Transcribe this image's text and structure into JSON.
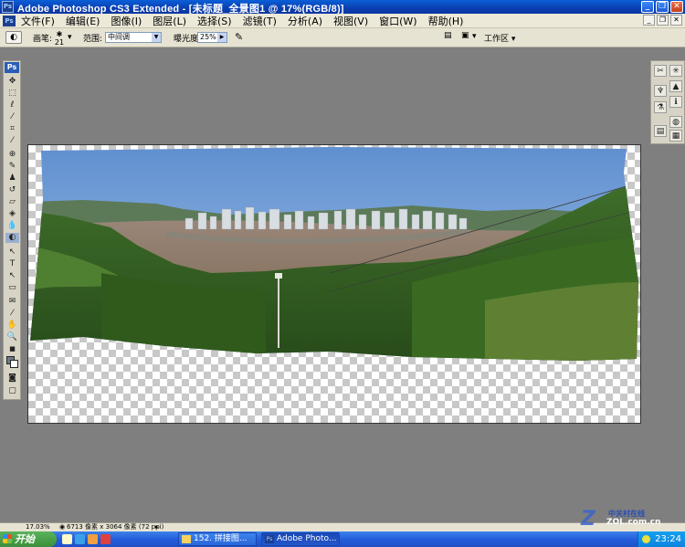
{
  "window": {
    "title": "Adobe Photoshop CS3 Extended - [未标题_全景图1 @ 17%(RGB/8)]"
  },
  "menu": [
    "文件(F)",
    "编辑(E)",
    "图像(I)",
    "图层(L)",
    "选择(S)",
    "滤镜(T)",
    "分析(A)",
    "视图(V)",
    "窗口(W)",
    "帮助(H)"
  ],
  "options": {
    "brush_label": "画笔:",
    "brush_size": "21",
    "range_label": "范围:",
    "range_value": "中间调",
    "exposure_label": "曝光度:",
    "exposure_value": "25%",
    "workspace_label": "工作区"
  },
  "toolbox": {
    "logo": "Ps"
  },
  "status": {
    "zoom": "17.03%",
    "doc_size": "6713 像素 x 3064 像素 (72 ppi)"
  },
  "taskbar": {
    "start_label": "开始",
    "tasks": [
      {
        "label": "152. 拼接图..."
      },
      {
        "label": "Adobe Photo..."
      }
    ],
    "clock": "23:24"
  },
  "watermark": {
    "brand": "中关村在线",
    "url": "ZOL.com.cn"
  },
  "colors": {
    "titlebar": "#0a4fc8",
    "workspace": "#7f7f7f",
    "taskbar": "#245edb",
    "start": "#3c8f3c"
  }
}
